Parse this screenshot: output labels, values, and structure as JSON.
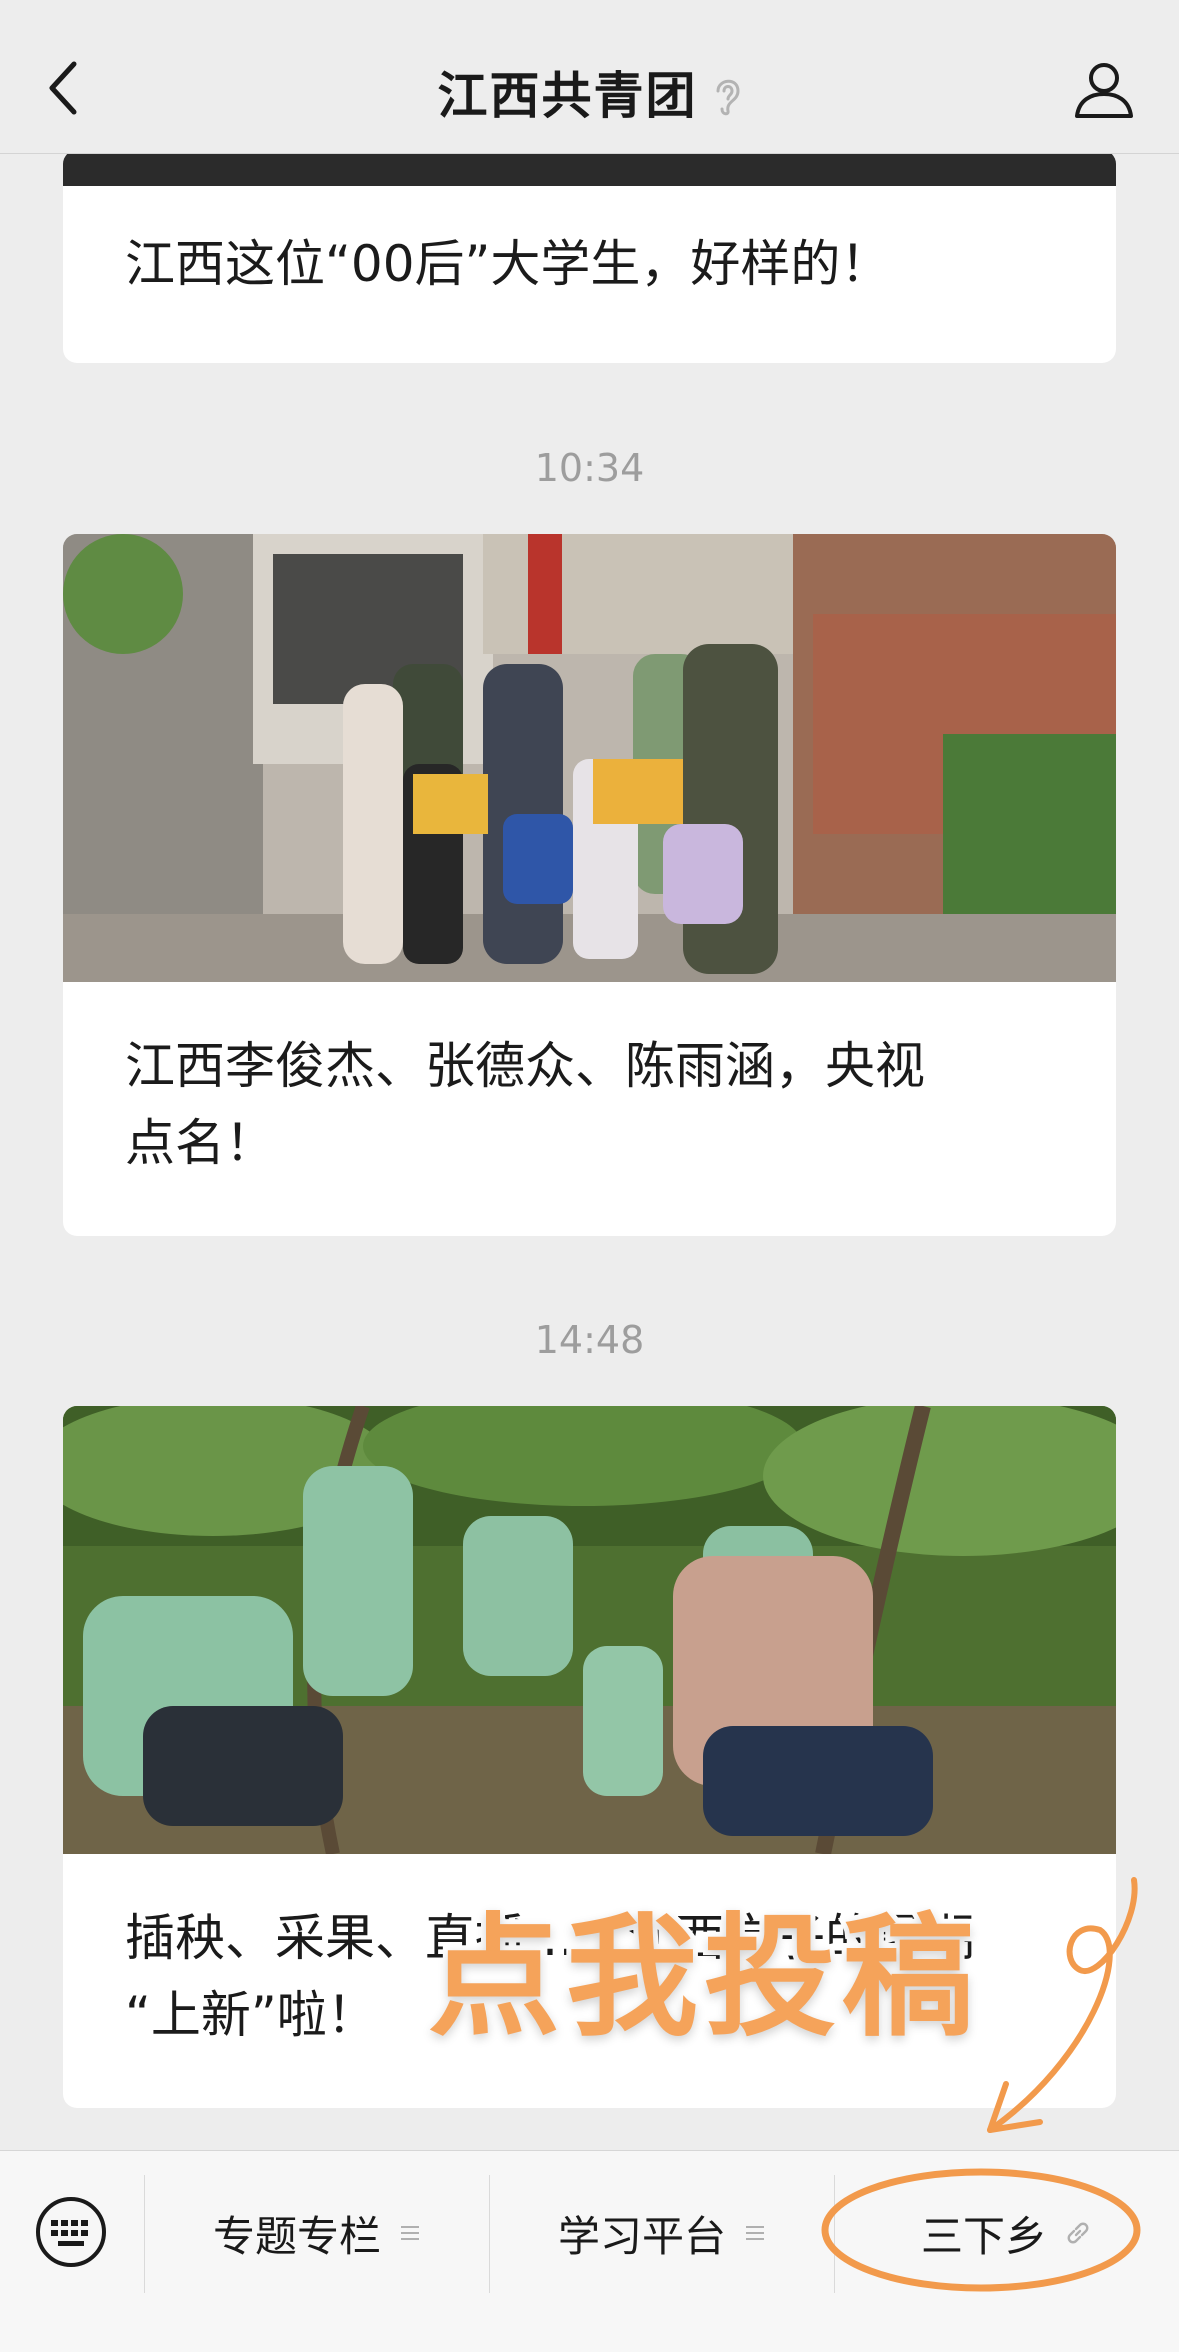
{
  "header": {
    "title": "江西共青团"
  },
  "feed": {
    "cards": [
      {
        "caption": "江西这位“00后”大学生，好样的！"
      },
      {
        "caption_line1": "江西李俊杰、张德众、陈雨涵，央视",
        "caption_line2": "点名！"
      },
      {
        "caption_line1": "插秧、采果、直播……江西学子的暑期",
        "caption_line2": "“上新”啦！"
      }
    ],
    "timestamps": [
      "10:34",
      "14:48"
    ]
  },
  "overlay": {
    "promo_text": "点我投稿",
    "accent_color": "#f29a4c"
  },
  "menu": {
    "items": [
      {
        "label": "专题专栏"
      },
      {
        "label": "学习平台"
      },
      {
        "label": "三下乡"
      }
    ]
  },
  "icons": [
    "back-icon",
    "ear-icon",
    "profile-icon",
    "keyboard-icon",
    "menu-lines-icon",
    "link-icon"
  ]
}
